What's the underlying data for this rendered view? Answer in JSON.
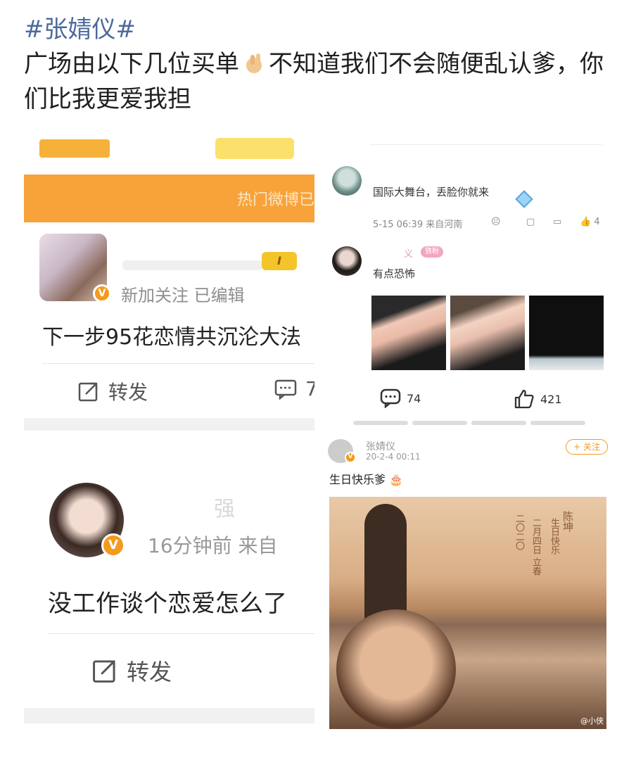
{
  "post": {
    "hashtag": "#张婧仪#",
    "text_before_emoji": "广场由以下几位买单",
    "text_after_emoji": "不知道我们不会随便乱认爹，你们比我更爱我担"
  },
  "left_top": {
    "orange_banner": "热门微博已",
    "meta": "新加关注  已编辑",
    "level": "I",
    "body": "下一步95花恋情共沉沦大法",
    "repost_label": "转发",
    "comment_count": "7"
  },
  "left_bottom": {
    "name_partial": "强",
    "meta": "16分钟前  来自",
    "body": "没工作谈个恋爱怎么了",
    "repost_label": "转发"
  },
  "right_top": {
    "comment1": "国际大舞台，丢脸你就来",
    "comment1_meta": "5-15 06:39  来自河南",
    "comment1_like": "4",
    "name2_partial": "义",
    "fan_badge": "铁粉",
    "comment2": "有点恐怖",
    "comments_count": "74",
    "likes_count": "421"
  },
  "right_bottom": {
    "username": "张婧仪",
    "date": "20-2-4 00:11",
    "follow": "+ 关注",
    "text": "生日快乐爹",
    "photo_name": "陈坤",
    "photo_line1": "生日快乐",
    "photo_line2": "二月四日 立春",
    "photo_year": "二〇二〇",
    "watermark": "@小侠"
  },
  "colors": {
    "hashtag": "#4d6a9c",
    "orange_banner": "#f8a23a",
    "v_badge": "#f39a1d"
  }
}
